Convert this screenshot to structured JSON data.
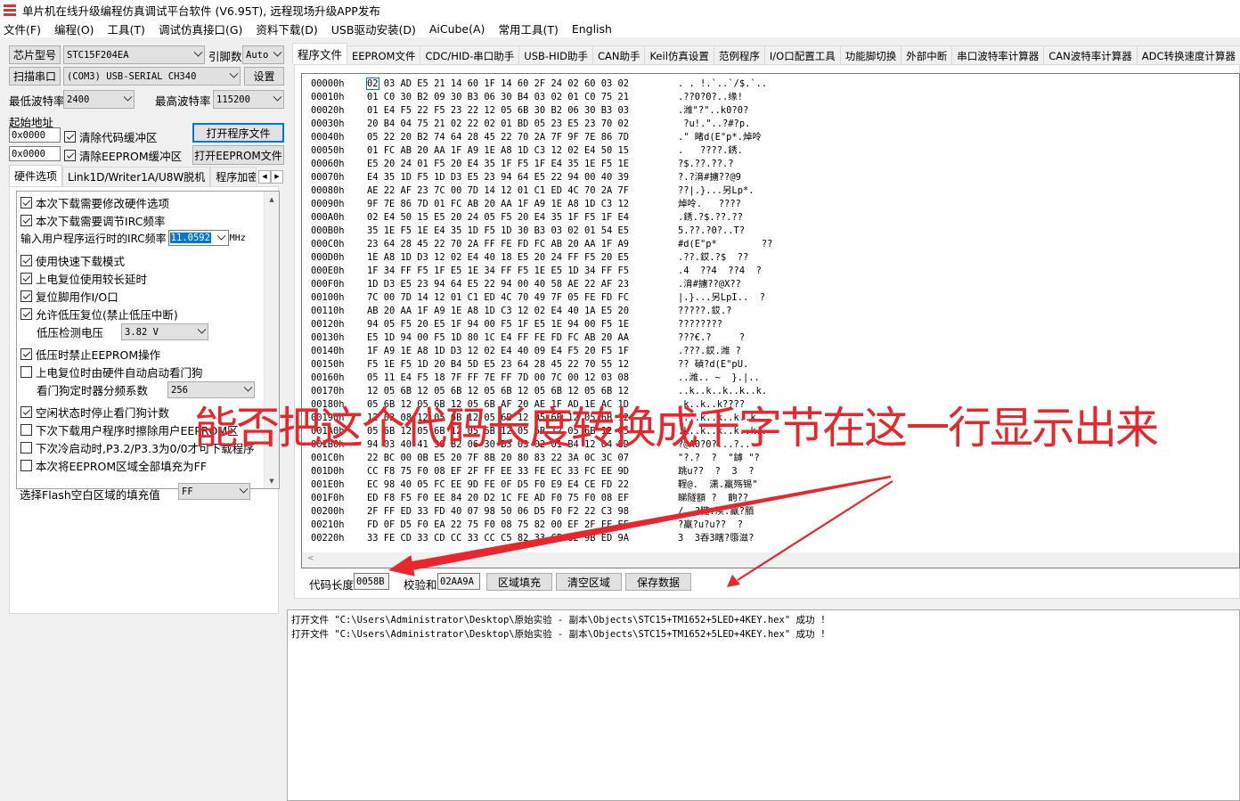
{
  "titlebar": {
    "title": "单片机在线升级编程仿真调试平台软件 (V6.95T), 远程现场升级APP发布"
  },
  "menu": [
    "文件(F)",
    "编程(O)",
    "工具(T)",
    "调试仿真接口(G)",
    "资料下载(D)",
    "USB驱动安装(D)",
    "AiCube(A)",
    "常用工具(T)",
    "English"
  ],
  "left": {
    "chip_btn": "芯片型号",
    "chip_value": "STC15F204EA",
    "pin_label": "引脚数",
    "pin_value": "Auto",
    "scan_btn": "扫描串口",
    "port_value": "(COM3) USB-SERIAL CH340",
    "settings_btn": "设置",
    "min_baud_label": "最低波特率",
    "min_baud_value": "2400",
    "max_baud_label": "最高波特率",
    "max_baud_value": "115200",
    "start_addr_label": "起始地址",
    "addr1": "0x0000",
    "clear_code": "清除代码缓冲区",
    "open_prog_btn": "打开程序文件",
    "addr2": "0x0000",
    "clear_eeprom": "清除EEPROM缓冲区",
    "open_eeprom_btn": "打开EEPROM文件",
    "tabs": [
      "硬件选项",
      "Link1D/Writer1A/U8W脱机",
      "程序加密后"
    ],
    "options": {
      "o1": "本次下载需要修改硬件选项",
      "o2": "本次下载需要调节IRC频率",
      "irc_label": "输入用户程序运行时的IRC频率",
      "irc_value": "11.0592",
      "irc_unit": "MHz",
      "o3": "使用快速下载模式",
      "o4": "上电复位使用较长延时",
      "o5": "复位脚用作I/O口",
      "o6": "允许低压复位(禁止低压中断)",
      "lv_label": "低压检测电压",
      "lv_value": "3.82 V",
      "o7": "低压时禁止EEPROM操作",
      "o8": "上电复位时由硬件自动启动看门狗",
      "wdt_label": "看门狗定时器分频系数",
      "wdt_value": "256",
      "o9": "空闲状态时停止看门狗计数",
      "o10": "下次下载用户程序时擦除用户EEPROM区",
      "o11": "下次冷启动时,P3.2/P3.3为0/0才可下载程序",
      "o12": "本次将EEPROM区域全部填充为FF"
    },
    "fill_label": "选择Flash空白区域的填充值",
    "fill_value": "FF"
  },
  "right_tabs": [
    "程序文件",
    "EEPROM文件",
    "CDC/HID-串口助手",
    "USB-HID助手",
    "CAN助手",
    "Keil仿真设置",
    "范例程序",
    "I/O口配置工具",
    "功能脚切换",
    "外部中断",
    "串口波特率计算器",
    "CAN波特率计算器",
    "ADC转换速度计算器"
  ],
  "hex_rows": [
    {
      "addr": "00000h",
      "hex": "02 03 AD E5 21 14 60 1F 14 60 2F 24 02 60 03 02",
      "ascii": ". . !.`..`/$.`.."
    },
    {
      "addr": "00010h",
      "hex": "01 C0 30 B2 09 30 B3 06 30 B4 03 02 01 C0 75 21",
      "ascii": ".??0?0?..缘!"
    },
    {
      "addr": "00020h",
      "hex": "01 E4 F5 22 F5 23 22 12 05 6B 30 B2 06 30 B3 03",
      "ascii": ".潍\"?\"..k0?0?"
    },
    {
      "addr": "00030h",
      "hex": "20 B4 04 75 21 02 22 02 01 BD 05 23 E5 23 70 02",
      "ascii": " ?u!.\"..?#?p."
    },
    {
      "addr": "00040h",
      "hex": "05 22 20 B2 74 64 28 45 22 70 2A 7F 9F 7E 86 7D",
      "ascii": ".\" 睹d(E\"p*.焯呤"
    },
    {
      "addr": "00050h",
      "hex": "01 FC AB 20 AA 1F A9 1E A8 1D C3 12 02 E4 50 15",
      "ascii": ".   ????.銹."
    },
    {
      "addr": "00060h",
      "hex": "E5 20 24 01 F5 20 E4 35 1F F5 1F E4 35 1E F5 1E",
      "ascii": "?$.??.??.?"
    },
    {
      "addr": "00070h",
      "hex": "E4 35 1D F5 1D D3 E5 23 94 64 E5 22 94 00 40 39",
      "ascii": "?.?湇#擄??@9"
    },
    {
      "addr": "00080h",
      "hex": "AE 22 AF 23 7C 00 7D 14 12 01 C1 ED 4C 70 2A 7F",
      "ascii": "??|.}...另Lp*."
    },
    {
      "addr": "00090h",
      "hex": "9F 7E 86 7D 01 FC AB 20 AA 1F A9 1E A8 1D C3 12",
      "ascii": "焯呤.   ????"
    },
    {
      "addr": "000A0h",
      "hex": "02 E4 50 15 E5 20 24 05 F5 20 E4 35 1F F5 1F E4",
      "ascii": ".銹.?$.??.??"
    },
    {
      "addr": "000B0h",
      "hex": "35 1E F5 1E E4 35 1D F5 1D 30 B3 03 02 01 54 E5",
      "ascii": "5.??.?0?..T?"
    },
    {
      "addr": "000C0h",
      "hex": "23 64 28 45 22 70 2A FF FE FD FC AB 20 AA 1F A9",
      "ascii": "#d(E\"p*        ??"
    },
    {
      "addr": "000D0h",
      "hex": "1E A8 1D D3 12 02 E4 40 18 E5 20 24 FF F5 20 E5",
      "ascii": ".??.銰.?$  ??"
    },
    {
      "addr": "000E0h",
      "hex": "1F 34 FF F5 1F E5 1E 34 FF F5 1E E5 1D 34 FF F5",
      "ascii": ".4  ??4  ??4  ?"
    },
    {
      "addr": "000F0h",
      "hex": "1D D3 E5 23 94 64 E5 22 94 00 40 58 AE 22 AF 23",
      "ascii": ".湇#擄??@X??"
    },
    {
      "addr": "00100h",
      "hex": "7C 00 7D 14 12 01 C1 ED 4C 70 49 7F 05 FE FD FC",
      "ascii": "|.}...另LpI..  ?"
    },
    {
      "addr": "00110h",
      "hex": "AB 20 AA 1F A9 1E A8 1D C3 12 02 E4 40 1A E5 20",
      "ascii": "?????.銰.?"
    },
    {
      "addr": "00120h",
      "hex": "94 05 F5 20 E5 1F 94 00 F5 1F E5 1E 94 00 F5 1E",
      "ascii": "????????"
    },
    {
      "addr": "00130h",
      "hex": "E5 1D 94 00 F5 1D 80 1C E4 FF FE FD FC AB 20 AA",
      "ascii": "???€.?     ?"
    },
    {
      "addr": "00140h",
      "hex": "1F A9 1E A8 1D D3 12 02 E4 40 09 E4 F5 20 F5 1F",
      "ascii": ".???.銰.潍 ?"
    },
    {
      "addr": "00150h",
      "hex": "F5 1E F5 1D 20 B4 5D E5 23 64 28 45 22 70 55 12",
      "ascii": "?? 碵?d(E\"pU."
    },
    {
      "addr": "00160h",
      "hex": "05 11 E4 F5 18 7F FF 7E FF 7D 00 7C 00 12 03 08",
      "ascii": "..潍.. ~  }.|.."
    },
    {
      "addr": "00170h",
      "hex": "12 05 6B 12 05 6B 12 05 6B 12 05 6B 12 05 6B 12",
      "ascii": "..k..k..k..k..k."
    },
    {
      "addr": "00180h",
      "hex": "05 6B 12 05 6B 12 05 6B AF 20 AE 1F AD 1E AC 1D",
      "ascii": ".k..k..k????"
    },
    {
      "addr": "00190h",
      "hex": "12 03 08 12 05 6B 12 05 6B 12 05 6B 12 05 6B 12",
      "ascii": "....k..k..k..k."
    },
    {
      "addr": "001A0h",
      "hex": "05 6B 12 05 6B 12 05 6B 12 05 6B 12 05 6B 12 05",
      "ascii": ".k..k..k..k..k.."
    },
    {
      "addr": "001B0h",
      "hex": "94 03 40 41 30 B2 06 30 B3 03 02 01 B4 12 04 8D",
      "ascii": "?@A0?0?...?.."
    },
    {
      "addr": "001C0h",
      "hex": "22 BC 00 0B E5 20 7F 8B 20 80 83 22 3A 0C 3C 07",
      "ascii": "\"?.?  ?  \"鏬 \"?"
    },
    {
      "addr": "001D0h",
      "hex": "CC F8 75 F0 08 EF 2F FF EE 33 FE EC 33 FC EE 9D",
      "ascii": "跳u??  ?  3  ?"
    },
    {
      "addr": "001E0h",
      "hex": "EC 98 40 05 FC EE 9D FE 0F D5 F0 E9 E4 CE FD 22",
      "ascii": "鞓@.  潇.羸殇锡\""
    },
    {
      "addr": "001F0h",
      "hex": "ED F8 F5 F0 EE 84 20 D2 1C FE AD F0 75 F0 08 EF",
      "ascii": "睇隧額 ?  齣??"
    },
    {
      "addr": "00200h",
      "hex": "2F FF ED 33 FD 40 07 98 50 06 D5 F0 F2 22 C3 98",
      "ascii": "/  ?朧.渎.羸?脜"
    },
    {
      "addr": "00210h",
      "hex": "FD 0F D5 F0 EA 22 75 F0 08 75 82 00 EF 2F FF EE",
      "ascii": "?羸?u?u??  ?"
    },
    {
      "addr": "00220h",
      "hex": "33 FE CD 33 CD CC 33 CC C5 82 33 C5 82 9B ED 9A",
      "ascii": "3  3吞3瞎?隳滋?"
    }
  ],
  "bottom": {
    "code_len_label": "代码长度",
    "code_len_value": "0058B",
    "checksum_label": "校验和",
    "checksum_value": "02AA9A",
    "fill_btn": "区域填充",
    "clear_btn": "清空区域",
    "save_btn": "保存数据"
  },
  "log": [
    "打开文件 \"C:\\Users\\Administrator\\Desktop\\原始实验 - 副本\\Objects\\STC15+TM1652+5LED+4KEY.hex\" 成功 !",
    "打开文件 \"C:\\Users\\Administrator\\Desktop\\原始实验 - 副本\\Objects\\STC15+TM1652+5LED+4KEY.hex\" 成功 !"
  ],
  "annotation": {
    "text": "能否把这个代码长度转换成千字节在这一行显示出来",
    "color": "#e8262b"
  }
}
